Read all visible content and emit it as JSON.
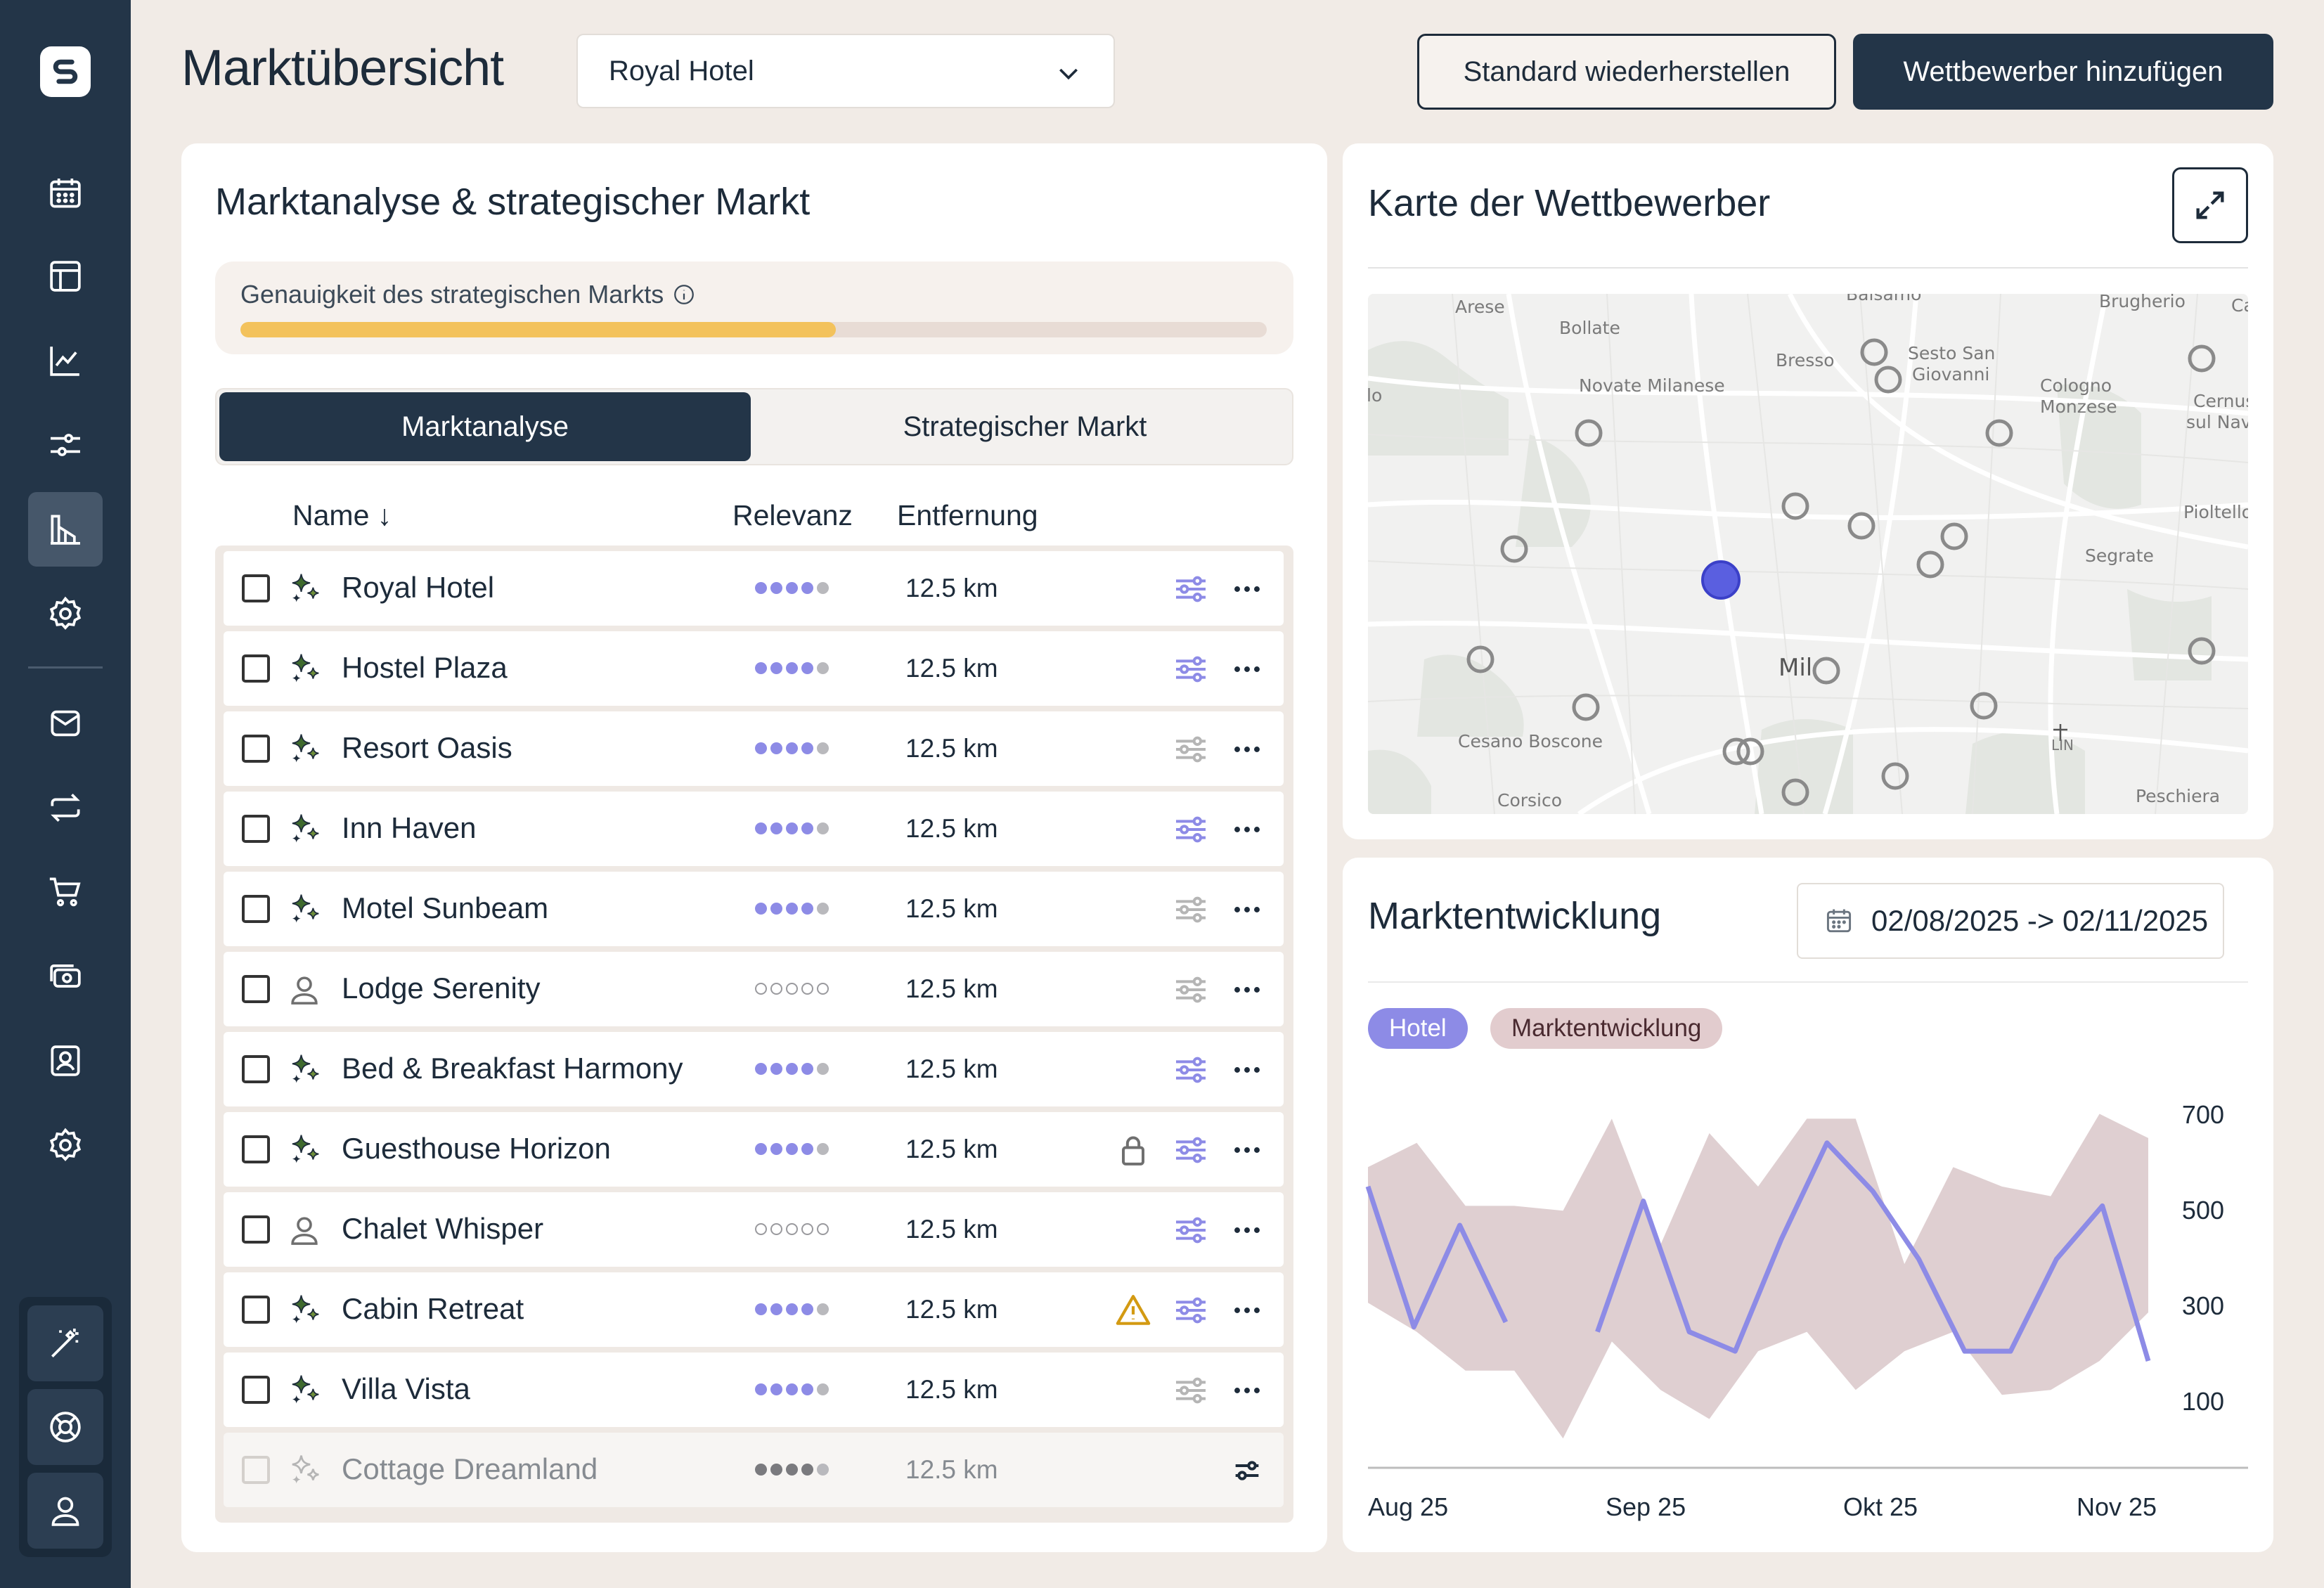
{
  "sidebar": {
    "nav_icons": [
      "calendar-icon",
      "layout-icon",
      "chart-line-icon",
      "sliders-icon",
      "market-icon",
      "gear-icon",
      "mail-icon",
      "exchange-icon",
      "cart-icon",
      "money-icon",
      "contact-icon",
      "settings-icon"
    ],
    "active_index": 4,
    "bottom_icons": [
      "magic-wand-icon",
      "help-icon",
      "user-icon"
    ]
  },
  "header": {
    "title": "Marktübersicht",
    "hotel_select": "Royal Hotel",
    "reset_button": "Standard wiederherstellen",
    "add_button": "Wettbewerber hinzufügen"
  },
  "market": {
    "title": "Marktanalyse & strategischer Markt",
    "accuracy_label": "Genauigkeit des strategischen Markts",
    "accuracy_fraction": 0.58,
    "tabs": [
      "Marktanalyse",
      "Strategischer Markt"
    ],
    "active_tab": 0,
    "columns": {
      "name": "Name ↓",
      "relevance": "Relevanz",
      "distance": "Entfernung"
    },
    "rows": [
      {
        "name": "Royal Hotel",
        "type": "ai",
        "relevance": 4,
        "distance": "12.5 km",
        "adjust": "active",
        "extra": ""
      },
      {
        "name": "Hostel Plaza",
        "type": "ai",
        "relevance": 4,
        "distance": "12.5 km",
        "adjust": "active",
        "extra": ""
      },
      {
        "name": "Resort Oasis",
        "type": "ai",
        "relevance": 4,
        "distance": "12.5 km",
        "adjust": "inactive",
        "extra": ""
      },
      {
        "name": "Inn Haven",
        "type": "ai",
        "relevance": 4,
        "distance": "12.5 km",
        "adjust": "active",
        "extra": ""
      },
      {
        "name": "Motel Sunbeam",
        "type": "ai",
        "relevance": 4,
        "distance": "12.5 km",
        "adjust": "inactive",
        "extra": ""
      },
      {
        "name": "Lodge Serenity",
        "type": "user",
        "relevance": 0,
        "distance": "12.5 km",
        "adjust": "inactive",
        "extra": ""
      },
      {
        "name": "Bed & Breakfast Harmony",
        "type": "ai",
        "relevance": 4,
        "distance": "12.5 km",
        "adjust": "active",
        "extra": ""
      },
      {
        "name": "Guesthouse Horizon",
        "type": "ai",
        "relevance": 4,
        "distance": "12.5 km",
        "adjust": "active",
        "extra": "lock"
      },
      {
        "name": "Chalet Whisper",
        "type": "user",
        "relevance": 0,
        "distance": "12.5 km",
        "adjust": "active",
        "extra": ""
      },
      {
        "name": "Cabin Retreat",
        "type": "ai",
        "relevance": 4,
        "distance": "12.5 km",
        "adjust": "active",
        "extra": "warning"
      },
      {
        "name": "Villa Vista",
        "type": "ai",
        "relevance": 4,
        "distance": "12.5 km",
        "adjust": "inactive",
        "extra": ""
      },
      {
        "name": "Cottage Dreamland",
        "type": "ai-disabled",
        "relevance": 4,
        "distance": "12.5 km",
        "adjust": "dark",
        "extra": "",
        "disabled": true
      }
    ]
  },
  "map": {
    "title": "Karte der Wettbewerber",
    "labels": [
      "Arese",
      "Bollate",
      "Balsamo",
      "Brugherio",
      "Bresso",
      "Sesto San",
      "Giovanni",
      "Novate Milanese",
      "Cologno",
      "Monzese",
      "Cernus",
      "sul Navi",
      "Pioltello",
      "Segrate",
      "Mil",
      "Cesano Boscone",
      "Corsico",
      "LIN",
      "Peschiera",
      "Ca",
      "lo"
    ]
  },
  "trend": {
    "title": "Marktentwicklung",
    "date_range": "02/08/2025 -> 02/11/2025",
    "legend": [
      "Hotel",
      "Marktentwicklung"
    ],
    "colors": {
      "hotel": "#8d8be6",
      "market": "#dfcfd1"
    }
  },
  "chart_data": {
    "type": "line",
    "x": [
      0,
      1,
      2,
      3,
      4,
      5,
      6,
      7,
      8,
      9,
      10,
      11,
      12,
      13,
      14,
      15,
      16
    ],
    "x_ticks": [
      "Aug 25",
      "Sep 25",
      "Okt 25",
      "Nov 25"
    ],
    "y_ticks": [
      "700",
      "500",
      "300",
      "100"
    ],
    "ylim": [
      0,
      740
    ],
    "series": [
      {
        "name": "Hotel",
        "type": "line",
        "values": [
          540,
          250,
          460,
          260,
          null,
          240,
          510,
          240,
          200,
          430,
          630,
          530,
          390,
          200,
          200,
          390,
          500,
          180
        ]
      },
      {
        "name": "Marktentwicklung",
        "type": "band",
        "upper": [
          580,
          630,
          500,
          500,
          490,
          680,
          420,
          650,
          540,
          680,
          680,
          380,
          580,
          540,
          520,
          690,
          640
        ],
        "lower": [
          300,
          240,
          160,
          160,
          20,
          220,
          120,
          60,
          200,
          240,
          120,
          200,
          240,
          110,
          120,
          180,
          280
        ]
      }
    ]
  }
}
